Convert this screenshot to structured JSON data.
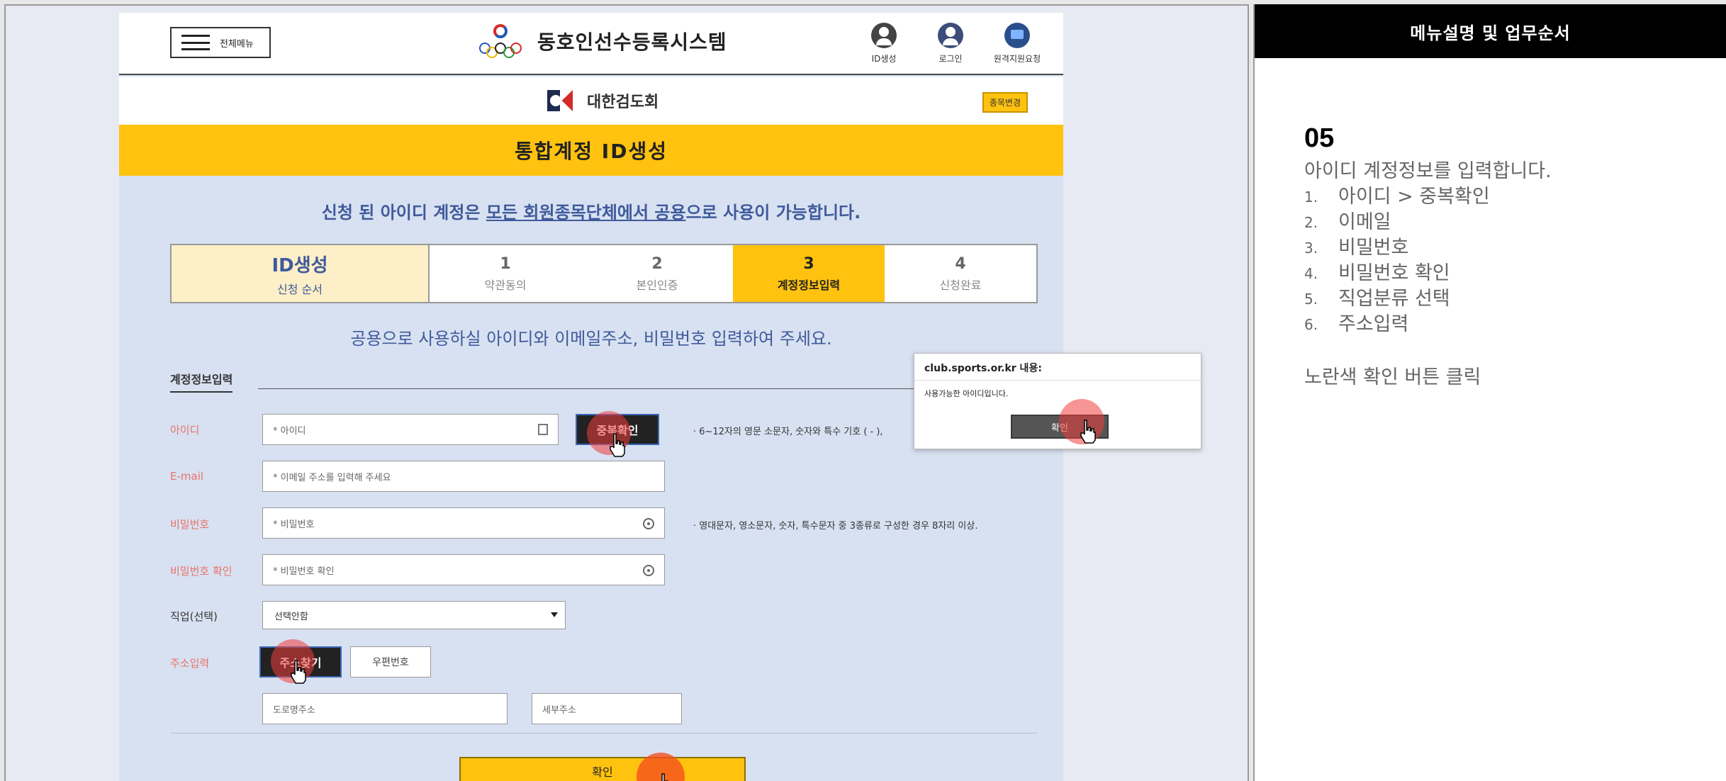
{
  "header": {
    "menu_label": "전체메뉴",
    "site_title": "동호인선수등록시스템",
    "icons": [
      {
        "label": "ID생성",
        "icon": "user-plus-icon"
      },
      {
        "label": "로그인",
        "icon": "user-icon"
      },
      {
        "label": "원격지원요청",
        "icon": "remote-support-icon"
      }
    ]
  },
  "org": {
    "name": "대한검도회",
    "change_button": "종목변경"
  },
  "page_title": "통합계정 ID생성",
  "notice": {
    "before": "신청 된 아이디 계정은 ",
    "underlined": "모든 회원종목단체에서 공용",
    "after": "으로 사용이 가능합니다."
  },
  "steps": {
    "title": "ID생성",
    "subtitle": "신청 순서",
    "items": [
      {
        "number": "1",
        "label": "약관동의",
        "active": false
      },
      {
        "number": "2",
        "label": "본인인증",
        "active": false
      },
      {
        "number": "3",
        "label": "계정정보입력",
        "active": true
      },
      {
        "number": "4",
        "label": "신청완료",
        "active": false
      }
    ]
  },
  "instruction": "공용으로 사용하실 아이디와 이메일주소, 비밀번호 입력하여 주세요.",
  "form": {
    "section_title": "계정정보입력",
    "id_label": "아이디",
    "id_placeholder": "* 아이디",
    "dup_check_button": "중복확인",
    "id_hint": "· 6~12자의 영문 소문자, 숫자와 특수 기호 ( - ),",
    "email_label": "E-mail",
    "email_placeholder": "* 이메일 주소를 입력해 주세요",
    "pw_label": "비밀번호",
    "pw_placeholder": "* 비밀번호",
    "pw_hint": "· 영대문자, 영소문자, 숫자, 특수문자 중 3종류로 구성한 경우 8자리 이상.",
    "pw_confirm_label": "비밀번호 확인",
    "pw_confirm_placeholder": "* 비밀번호 확인",
    "job_label": "직업(선택)",
    "job_selected": "선택안함",
    "address_label": "주소입력",
    "address_search_button": "주소찾기",
    "zip_button": "우편번호",
    "road_address_placeholder": "도로명주소",
    "detail_address_placeholder": "세부주소",
    "confirm_button": "확인"
  },
  "dialog": {
    "title": "club.sports.or.kr 내용:",
    "message": "사용가능한 아이디입니다.",
    "ok_button": "확인"
  },
  "panel": {
    "header": "메뉴설명 및 업무순서",
    "step_number": "05",
    "description": "아이디 계정정보를 입력합니다.",
    "items": [
      {
        "num": "1.",
        "text": "아이디 > 중복확인"
      },
      {
        "num": "2.",
        "text": "이메일"
      },
      {
        "num": "3.",
        "text": "비밀번호"
      },
      {
        "num": "4.",
        "text": "비밀번호 확인"
      },
      {
        "num": "5.",
        "text": "직업분류 선택"
      },
      {
        "num": "6.",
        "text": "주소입력"
      }
    ],
    "note": "노란색 확인 버튼 클릭"
  },
  "colors": {
    "accent_yellow": "#ffc20e",
    "brand_blue": "#3f5a9c",
    "label_red": "#e8736a",
    "click_marker": "#f03c3c"
  }
}
